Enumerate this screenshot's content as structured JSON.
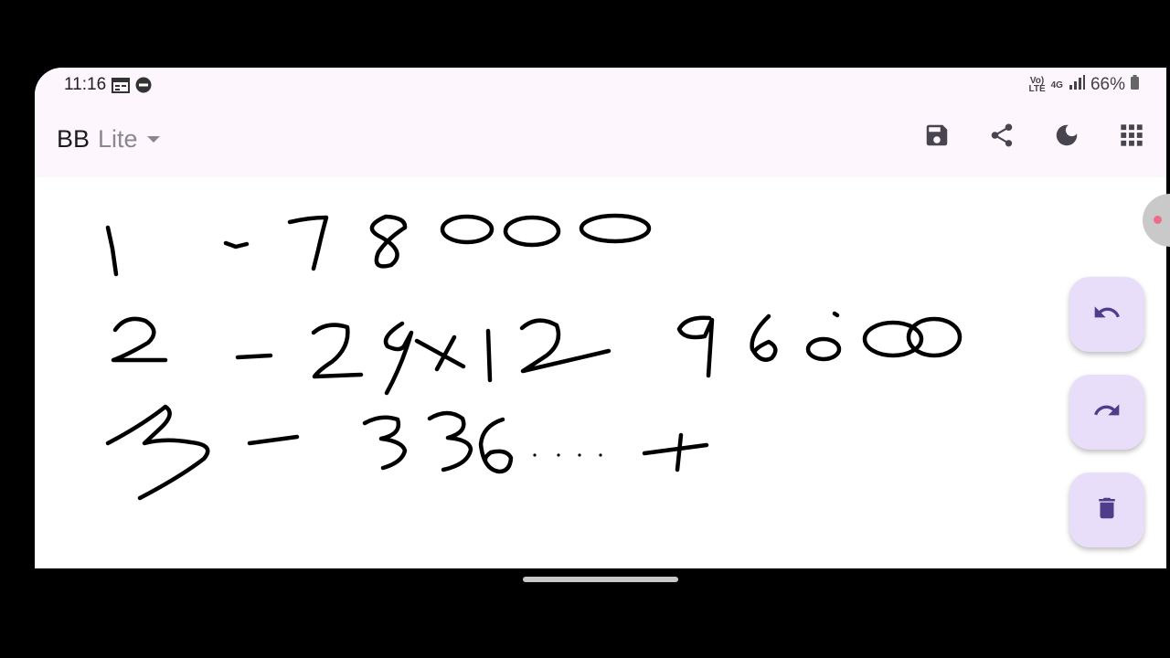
{
  "status_bar": {
    "time": "11:16",
    "left_icons": [
      "calendar-icon",
      "do-not-disturb-icon"
    ],
    "network_volte": "Vo)\nLTE",
    "network_type": "4G",
    "battery": "66%"
  },
  "app_bar": {
    "title": "BB",
    "subtitle": "Lite",
    "actions": [
      "save-icon",
      "share-icon",
      "dark-mode-icon",
      "apps-grid-icon"
    ]
  },
  "canvas": {
    "content": "handwritten ink strokes",
    "stroke_color": "#000000"
  },
  "fabs": [
    "undo-icon",
    "redo-icon",
    "delete-icon"
  ],
  "colors": {
    "app_bar_bg": "#fdf6fc",
    "fab_bg": "#e8defa",
    "fab_icon": "#4f3d8c",
    "toolbar_icon": "#49454f"
  }
}
